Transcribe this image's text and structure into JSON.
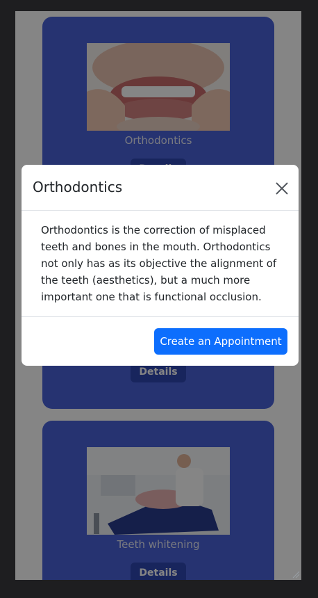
{
  "cards": [
    {
      "image": "aligner-photo",
      "caption": "Orthodontics",
      "button": "Details"
    },
    {
      "image": "",
      "caption": "",
      "button": "Details"
    },
    {
      "image": "dental-chair-photo",
      "caption": "Teeth whitening",
      "button": "Details"
    }
  ],
  "modal": {
    "title": "Orthodontics",
    "close_icon": "close-icon",
    "body": "Orthodontics is the correction of misplaced teeth and bones in the mouth. Orthodontics not only has as its objective the alignment of the teeth (aesthetics), but a much more important one that is functional occlusion.",
    "primary_button": "Create an Appointment"
  },
  "colors": {
    "card": "#4a63d8",
    "details_button": "#2f47b3",
    "primary_button": "#0d6efd",
    "backdrop": "#000000"
  }
}
